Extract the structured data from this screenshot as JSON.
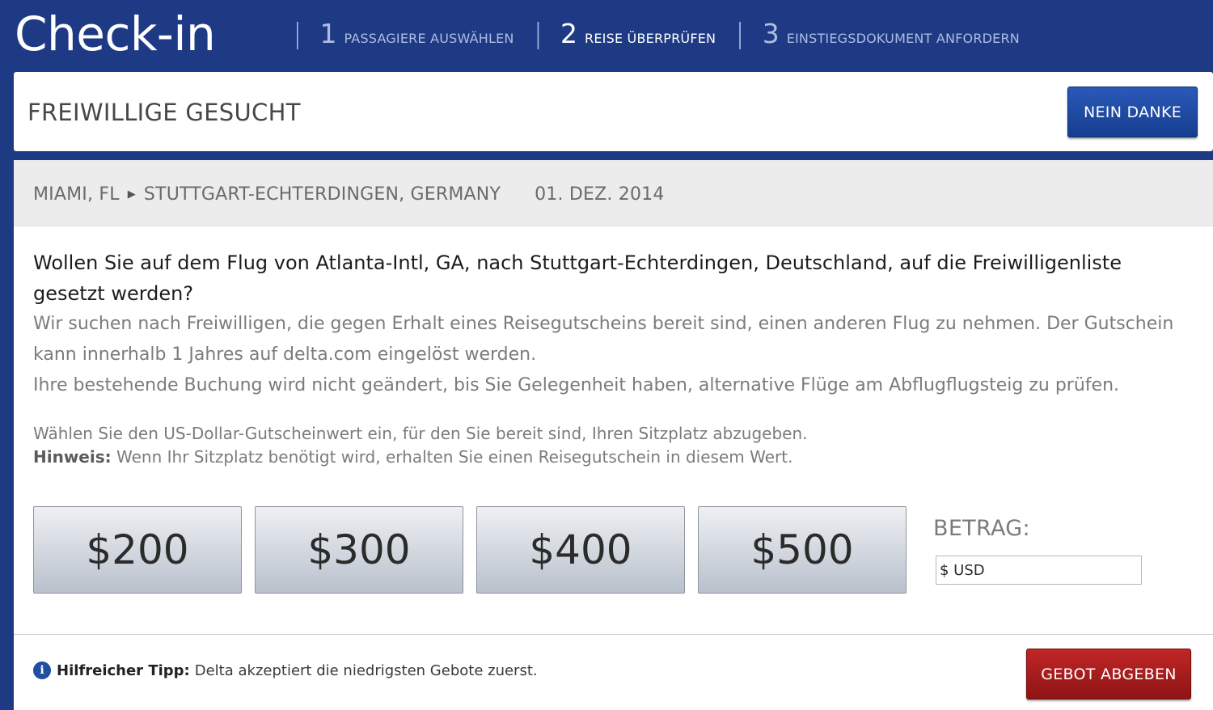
{
  "header": {
    "title": "Check-in",
    "steps": [
      {
        "num": "1",
        "label": "PASSAGIERE AUSWÄHLEN"
      },
      {
        "num": "2",
        "label": "REISE ÜBERPRÜFEN"
      },
      {
        "num": "3",
        "label": "EINSTIEGSDOKUMENT ANFORDERN"
      }
    ],
    "active_step": 2
  },
  "volunteer": {
    "heading": "FREIWILLIGE GESUCHT",
    "decline_label": "NEIN DANKE"
  },
  "trip": {
    "origin": "MIAMI, FL",
    "arrow": "▶",
    "destination": "STUTTGART-ECHTERDINGEN, GERMANY",
    "date": "01. DEZ. 2014"
  },
  "content": {
    "question": "Wollen Sie auf dem Flug von Atlanta-Intl, GA, nach Stuttgart-Echterdingen, Deutschland, auf die Freiwilligenliste gesetzt werden?",
    "description_1": "Wir suchen nach Freiwilligen, die gegen Erhalt eines Reisegutscheins bereit sind, einen anderen Flug zu nehmen. Der Gutschein kann innerhalb 1 Jahres auf delta.com eingelöst werden.",
    "description_2": "Ihre bestehende Buchung wird nicht geändert, bis Sie Gelegenheit haben, alternative Flüge am Abflugflugsteig zu prüfen.",
    "instruction": "Wählen Sie den US-Dollar-Gutscheinwert ein, für den Sie bereit sind, Ihren Sitzplatz abzugeben.",
    "note_label": "Hinweis:",
    "note_text": "Wenn Ihr Sitzplatz benötigt wird, erhalten Sie einen Reisegutschein in diesem Wert."
  },
  "amounts": [
    "$200",
    "$300",
    "$400",
    "$500"
  ],
  "bid": {
    "label": "BETRAG:",
    "input_value": "$ USD",
    "submit_label": "GEBOT ABGEBEN"
  },
  "tip": {
    "icon": "info-icon",
    "label": "Hilfreicher Tipp:",
    "text": "Delta akzeptiert die niedrigsten Gebote zuerst."
  },
  "colors": {
    "background": "#1f3a85",
    "primary_button": "#1f4ea3",
    "submit_button": "#a81c1c"
  }
}
